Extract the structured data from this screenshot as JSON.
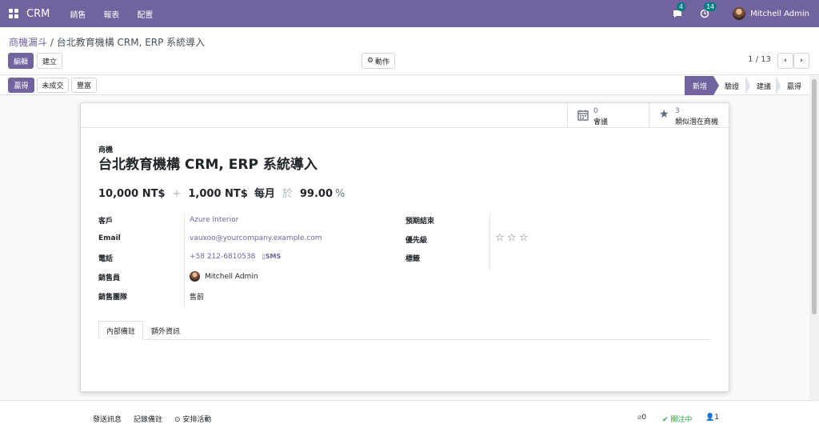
{
  "navbar": {
    "app_name": "CRM",
    "menu": [
      "銷售",
      "報表",
      "配置"
    ],
    "messages_count": "4",
    "activities_count": "14",
    "user_name": "Mitchell Admin",
    "bg_color": "#71639e"
  },
  "control_panel": {
    "breadcrumb_root": "商機漏斗",
    "breadcrumb_sep": " / ",
    "breadcrumb_current": "台北教育機構 CRM, ERP 系統導入",
    "edit_label": "編輯",
    "create_label": "建立",
    "action_label": "動作",
    "pager": "1 / 13"
  },
  "statusbar": {
    "buttons": [
      "贏得",
      "未成交",
      "豐富"
    ],
    "stages": [
      "新增",
      "驗證",
      "建議",
      "贏得"
    ],
    "active_stage": "新增"
  },
  "smart_buttons": [
    {
      "value": "0",
      "label": "會議",
      "icon": "calendar-icon"
    },
    {
      "value": "3",
      "label": "類似潛在商機",
      "icon": "star-icon"
    }
  ],
  "lead": {
    "type_label": "商機",
    "title": "台北教育機構 CRM, ERP 系統導入",
    "expected_revenue": "10,000 NT$",
    "plus": "+",
    "recurring_revenue": "1,000 NT$",
    "recurring_plan": "每月",
    "at": "於",
    "probability": "99.00",
    "percent": "%"
  },
  "fields_left": [
    {
      "label": "客戶",
      "value": "Azure Interior"
    },
    {
      "label": "Email",
      "value": "vauxoo@yourcompany.example.com"
    },
    {
      "label": "電話",
      "value": "+58 212-6810538",
      "extra": "SMS"
    },
    {
      "label": "銷售員",
      "value": "Mitchell Admin"
    },
    {
      "label": "銷售團隊",
      "value": "售前"
    }
  ],
  "fields_right": [
    {
      "label": "預期結束",
      "value": ""
    },
    {
      "label": "優先級",
      "value": ""
    },
    {
      "label": "標籤",
      "value": ""
    }
  ],
  "priority_stars": 0,
  "tabs": [
    "內部備註",
    "額外資訊"
  ],
  "chatter": {
    "send_message": "發送訊息",
    "log_note": "記錄備註",
    "schedule_activity": "安排活動",
    "attachments": "0",
    "following": "關注中",
    "followers": "1"
  }
}
